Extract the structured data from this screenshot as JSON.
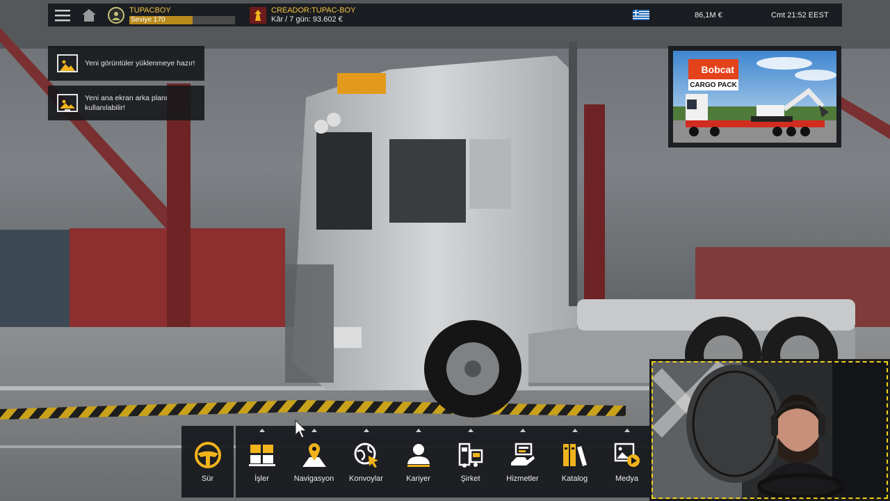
{
  "topbar": {
    "player_name": "TUPACBOY",
    "level_label": "Seviye 170",
    "level_progress": 0.6,
    "company_name": "CREADOR:TUPAC-BOY",
    "company_profit": "Kâr / 7 gün: 93.602 €",
    "money": "86,1M  €",
    "clock": "Cmt 21:52 EEST",
    "icons": [
      "hamburger-menu-icon",
      "home-icon",
      "avatar-icon",
      "company-logo-icon",
      "greece-flag-icon"
    ]
  },
  "notifications": [
    {
      "text": "Yeni görüntüler yüklenmeye hazır!",
      "icon": "image-icon"
    },
    {
      "text": "Yeni ana ekran arka planı kullanılabilir!",
      "icon": "monitor-image-icon"
    }
  ],
  "promo": {
    "brand": "Bobcat",
    "subtitle": "CARGO PACK"
  },
  "nav": {
    "drive_label": "Sür",
    "items": [
      {
        "label": "İşler",
        "icon": "jobs-icon"
      },
      {
        "label": "Navigasyon",
        "icon": "navigation-icon"
      },
      {
        "label": "Konvoylar",
        "icon": "convoy-icon"
      },
      {
        "label": "Kariyer",
        "icon": "career-icon"
      },
      {
        "label": "Şirket",
        "icon": "company-icon"
      },
      {
        "label": "Hizmetler",
        "icon": "services-icon"
      },
      {
        "label": "Katalog",
        "icon": "catalog-icon"
      },
      {
        "label": "Medya",
        "icon": "media-icon"
      }
    ]
  },
  "colors": {
    "accent_gold": "#f5c542",
    "panel_bg": "#16181c",
    "level_fill": "#b98a1c",
    "icon_white": "#ffffff",
    "icon_gold": "#f2b31c",
    "bobcat_red": "#e3421b"
  }
}
